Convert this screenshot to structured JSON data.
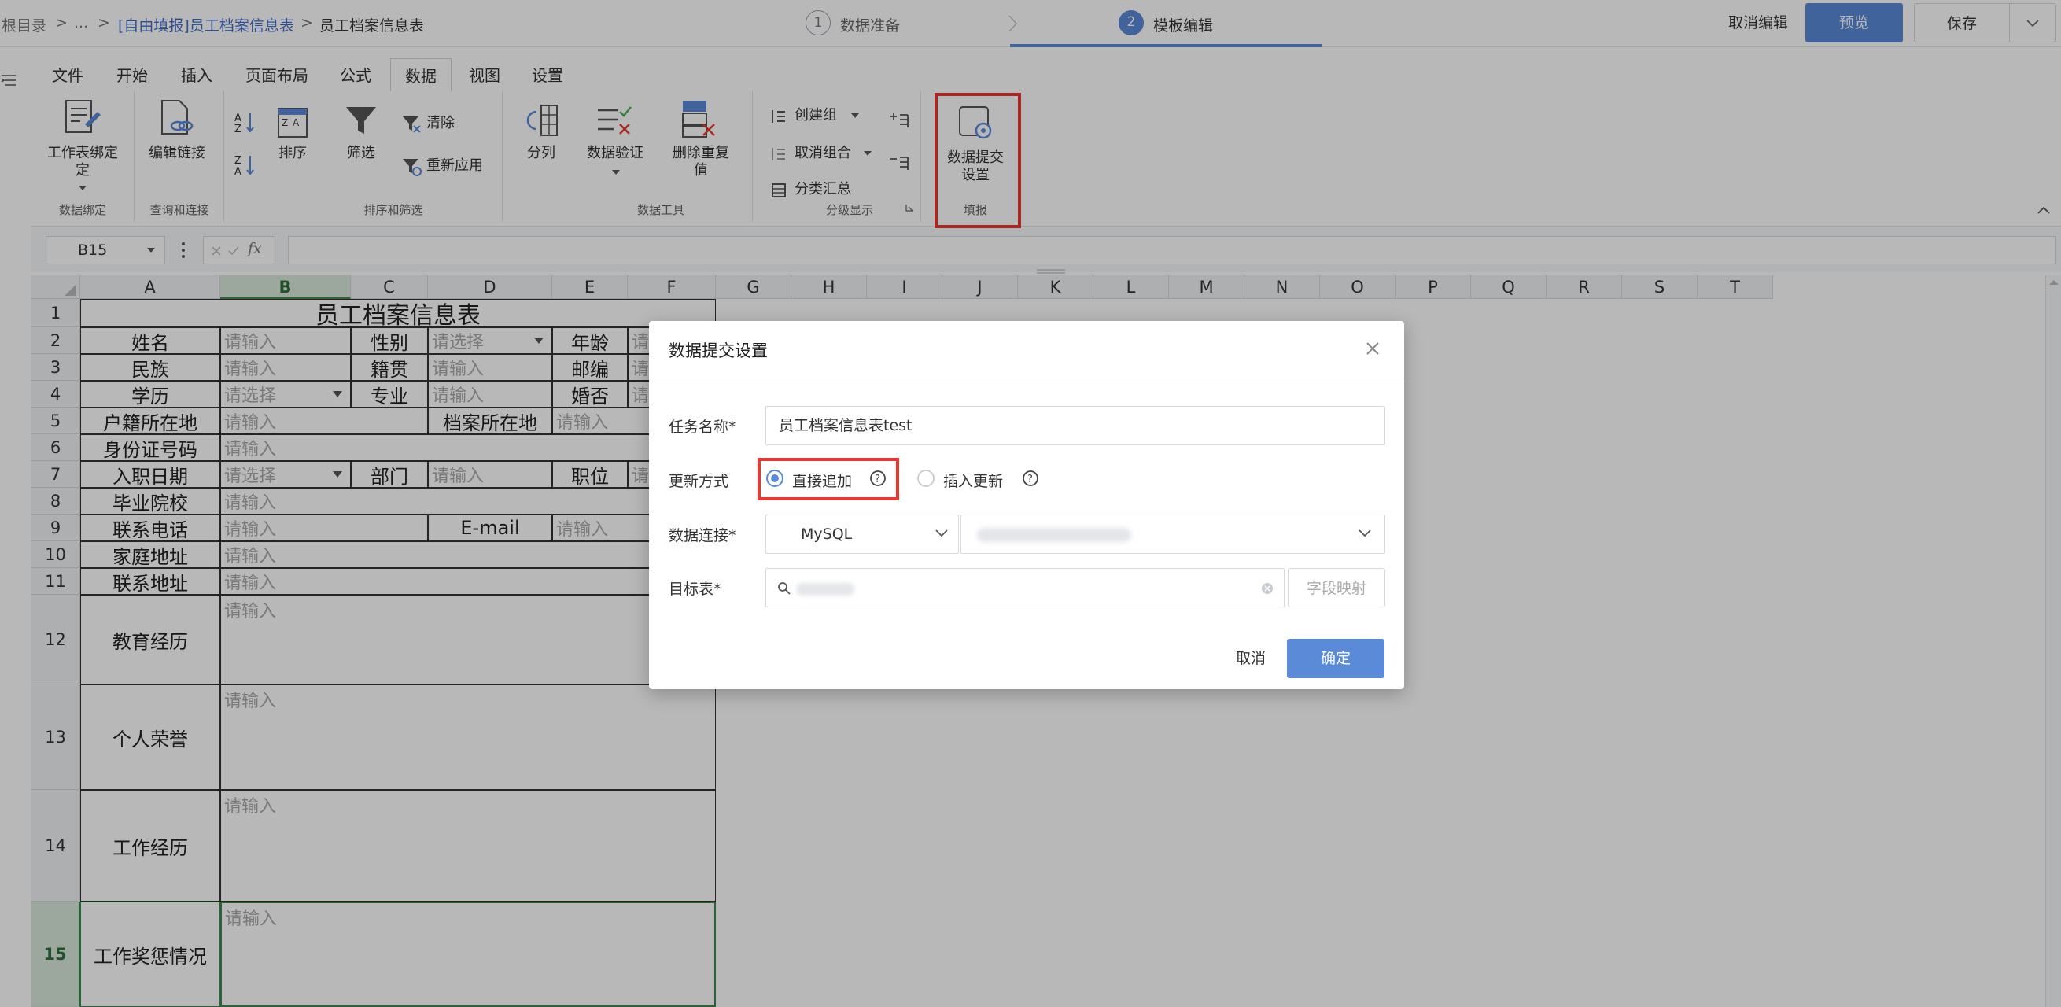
{
  "breadcrumb": {
    "root": "根目录",
    "sep1": ">",
    "ellipsis": "...",
    "sep2": ">",
    "parent": "[自由填报]员工档案信息表",
    "sep3": ">",
    "current": "员工档案信息表"
  },
  "steps": [
    {
      "num": "1",
      "label": "数据准备"
    },
    {
      "num": "2",
      "label": "模板编辑"
    }
  ],
  "top_actions": {
    "cancel": "取消编辑",
    "preview": "预览",
    "save": "保存"
  },
  "tabs": [
    "文件",
    "开始",
    "插入",
    "页面布局",
    "公式",
    "数据",
    "视图",
    "设置"
  ],
  "active_tab": "数据",
  "ribbon": {
    "bind_sheet": "工作表绑定",
    "bind_sheet_2": "定",
    "edit_link": "编辑链接",
    "sort": "排序",
    "filter": "筛选",
    "clear": "清除",
    "reapply": "重新应用",
    "split": "分列",
    "validate": "数据验证",
    "dedupe": "删除重复",
    "dedupe_2": "值",
    "create_group": "创建组",
    "ungroup": "取消组合",
    "subtotal": "分类汇总",
    "submit_settings": "数据提交",
    "submit_settings_2": "设置",
    "groups": {
      "data_binding": "数据绑定",
      "query_link": "查询和连接",
      "sort_filter": "排序和筛选",
      "data_tools": "数据工具",
      "outline": "分级显示",
      "fill": "填报"
    }
  },
  "formula_bar": {
    "cell_ref": "B15",
    "fx": "fx"
  },
  "columns": [
    "A",
    "B",
    "C",
    "D",
    "E",
    "F",
    "G",
    "H",
    "I",
    "J",
    "K",
    "L",
    "M",
    "N",
    "O",
    "P",
    "Q",
    "R",
    "S",
    "T"
  ],
  "rows": [
    "1",
    "2",
    "3",
    "4",
    "5",
    "6",
    "7",
    "8",
    "9",
    "10",
    "11",
    "12",
    "13",
    "14",
    "15"
  ],
  "sheet": {
    "title": "员工档案信息表",
    "placeholder_input": "请输入",
    "placeholder_select": "请选择",
    "placeholder_short": "请",
    "labels": {
      "name": "姓名",
      "gender": "性别",
      "age": "年龄",
      "ethnicity": "民族",
      "origin": "籍贯",
      "zip": "邮编",
      "education": "学历",
      "major": "专业",
      "married": "婚否",
      "hukou": "户籍所在地",
      "archive": "档案所在地",
      "id_number": "身份证号码",
      "hire_date": "入职日期",
      "dept": "部门",
      "position": "职位",
      "school": "毕业院校",
      "phone": "联系电话",
      "email": "E-mail",
      "home": "家庭地址",
      "contact_addr": "联系地址",
      "edu_history": "教育经历",
      "honors": "个人荣誉",
      "work_history": "工作经历",
      "rewards": "工作奖惩情况"
    }
  },
  "dialog": {
    "title": "数据提交设置",
    "task_name_label": "任务名称*",
    "task_name_value": "员工档案信息表test",
    "update_mode_label": "更新方式",
    "option_append": "直接追加",
    "option_upsert": "插入更新",
    "selected_option": "直接追加",
    "connection_label": "数据连接*",
    "connection_type": "MySQL",
    "target_label": "目标表*",
    "field_mapping": "字段映射",
    "cancel": "取消",
    "confirm": "确定"
  },
  "colors": {
    "primary": "#5b8ad8",
    "highlight_red": "#e8382f",
    "selected_col": "#d9e9dc"
  }
}
